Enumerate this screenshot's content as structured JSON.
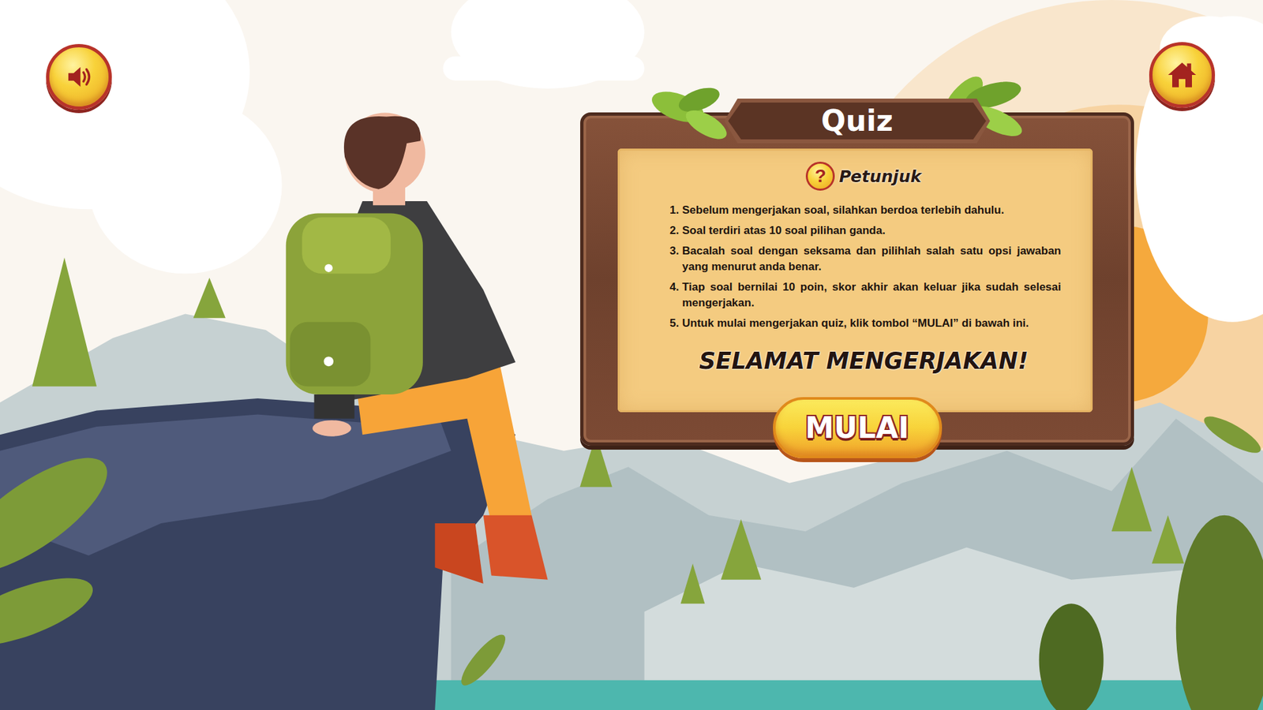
{
  "board": {
    "title": "Quiz",
    "help_icon_glyph": "?",
    "heading": "Petunjuk",
    "instructions": [
      "Sebelum mengerjakan soal, silahkan berdoa terlebih dahulu.",
      "Soal terdiri atas 10 soal pilihan ganda.",
      "Bacalah soal dengan seksama dan pilihlah salah satu opsi jawaban yang menurut anda benar.",
      "Tiap soal bernilai 10 poin, skor akhir akan keluar jika sudah selesai mengerjakan.",
      "Untuk mulai mengerjakan quiz, klik tombol “MULAI” di bawah ini."
    ],
    "closing": "SELAMAT MENGERJAKAN!",
    "start_button": "MULAI"
  }
}
